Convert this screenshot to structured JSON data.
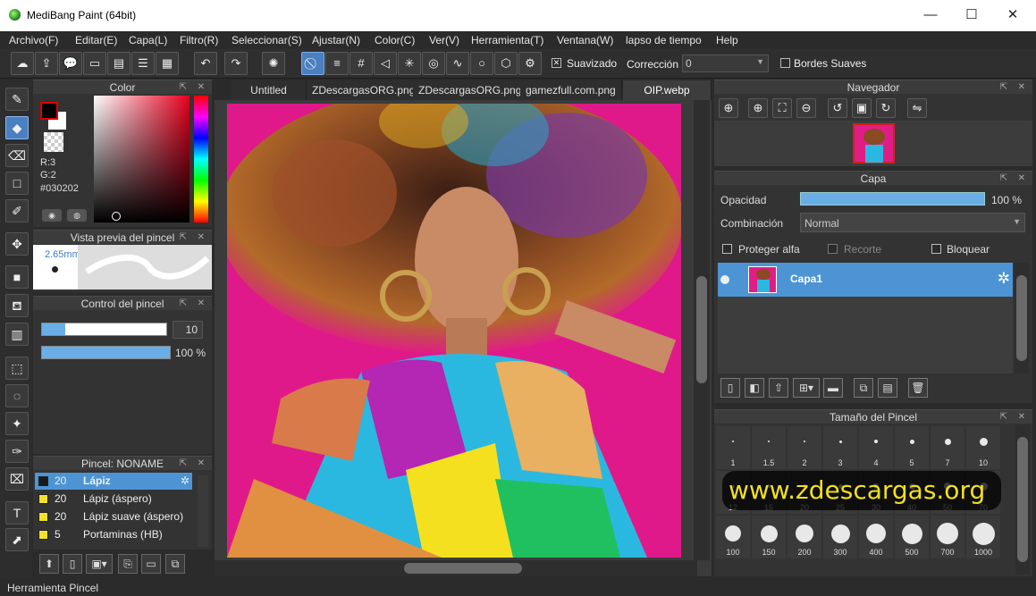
{
  "window": {
    "title": "MediBang Paint (64bit)",
    "min": "—",
    "max": "☐",
    "close": "✕"
  },
  "menu": [
    "Archivo(F)",
    "Editar(E)",
    "Capa(L)",
    "Filtro(R)",
    "Seleccionar(S)",
    "Ajustar(N)",
    "Color(C)",
    "Ver(V)",
    "Herramienta(T)",
    "Ventana(W)",
    "lapso de tiempo",
    "Help"
  ],
  "toolbar": {
    "suavizado_label": "Suavizado",
    "suavizado_checked": true,
    "correccion_label": "Corrección",
    "correccion_value": "0",
    "bordes_label": "Bordes Suaves"
  },
  "color_panel": {
    "title": "Color",
    "r": "R:3",
    "g": "G:2",
    "hex": "#030202",
    "fg": "#030202",
    "bg": "#ffffff"
  },
  "brush_preview": {
    "title": "Vista previa del pincel",
    "size": "2.65mm"
  },
  "brush_control": {
    "title": "Control del pincel",
    "size_value": "10",
    "opacity_value": "100 %"
  },
  "brush_list": {
    "title": "Pincel: NONAME",
    "items": [
      {
        "size": "20",
        "name": "Lápiz",
        "selected": true,
        "color": "#1a1a1a"
      },
      {
        "size": "20",
        "name": "Lápiz (áspero)",
        "selected": false,
        "color": "#f3e12a"
      },
      {
        "size": "20",
        "name": "Lápiz suave (áspero)",
        "selected": false,
        "color": "#f3e12a"
      },
      {
        "size": "5",
        "name": "Portaminas (HB)",
        "selected": false,
        "color": "#f3e12a"
      }
    ]
  },
  "tabs": [
    "Untitled",
    "ZDescargasORG.png",
    "ZDescargasORG.png",
    "gamezfull.com.png",
    "OIP.webp"
  ],
  "active_tab": 4,
  "navigator": {
    "title": "Navegador"
  },
  "layer_panel": {
    "title": "Capa",
    "opacity_label": "Opacidad",
    "opacity_value": "100 %",
    "blend_label": "Combinación",
    "blend_value": "Normal",
    "protect_alpha": "Proteger alfa",
    "clip": "Recorte",
    "lock": "Bloquear",
    "layers": [
      {
        "name": "Capa1"
      }
    ]
  },
  "brush_size_panel": {
    "title": "Tamaño del Pincel",
    "sizes": [
      "1",
      "1.5",
      "2",
      "3",
      "4",
      "5",
      "7",
      "10",
      "12",
      "15",
      "20",
      "25",
      "30",
      "40",
      "50",
      "70",
      "100",
      "150",
      "200",
      "300",
      "400",
      "500",
      "700",
      "1000"
    ]
  },
  "watermark": "www.zdescargas.org",
  "status": "Herramienta Pincel"
}
